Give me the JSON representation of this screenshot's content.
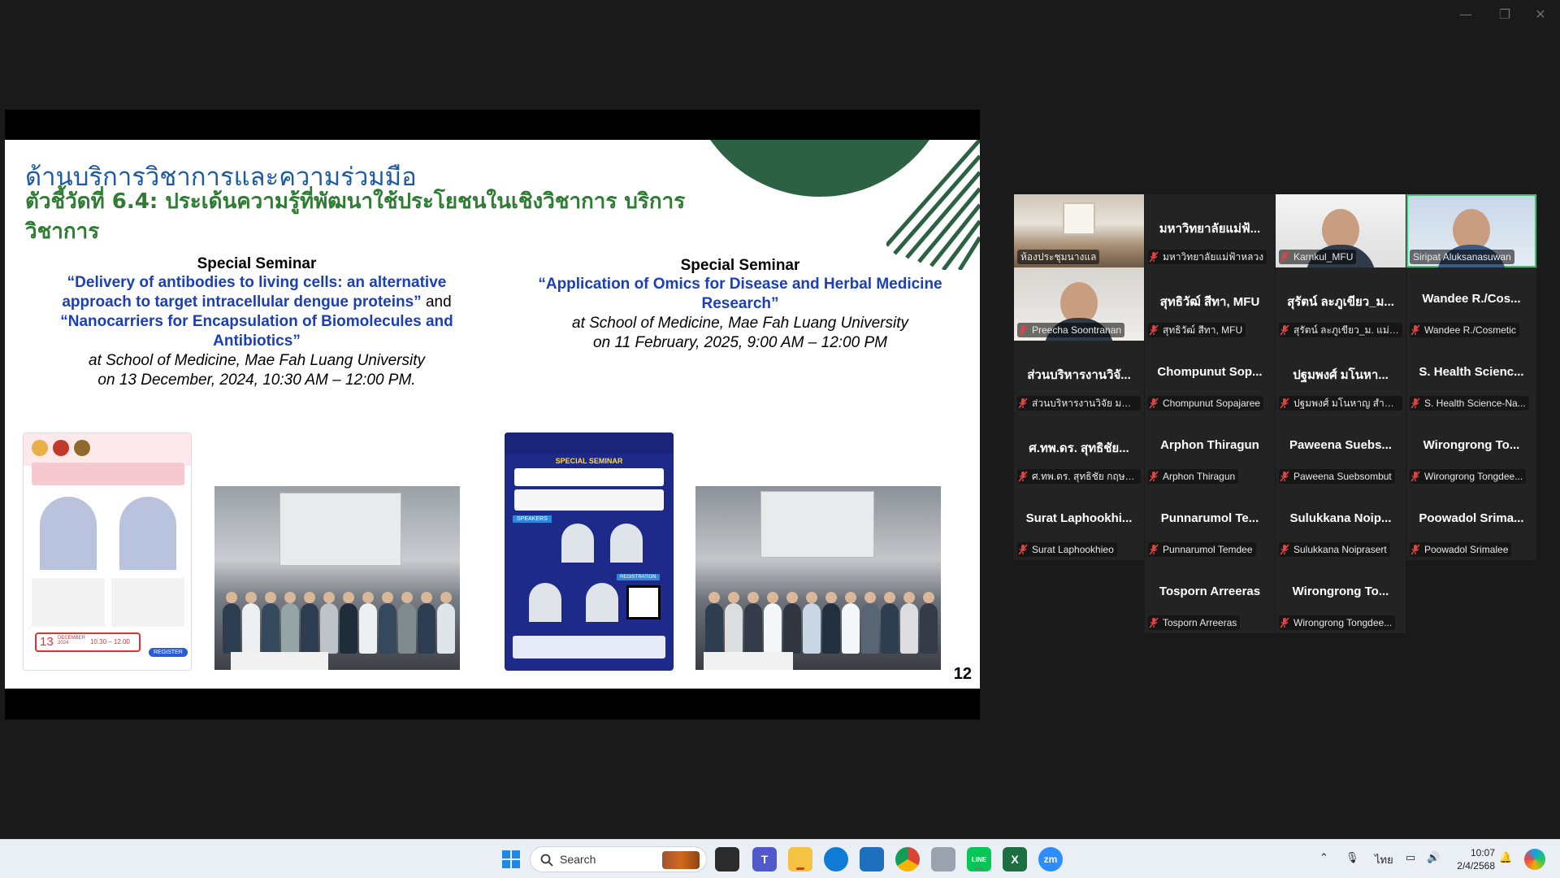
{
  "window": {
    "minimize": "—",
    "restore": "❐",
    "close": "✕"
  },
  "slide": {
    "heading": "ด้านบริการวิชาการและความร่วมมือ",
    "subheading": "ตัวชี้วัดที่ 6.4: ประเด้นความรู้ที่พัฒนาใช้ประโยชนในเชิงวิชาการ บริการวิชาการ",
    "seminar1": {
      "kind": "Special Seminar",
      "title_a": "“Delivery of antibodies to living cells: an alternative approach to target intracellular dengue proteins”",
      "and": "and",
      "title_b": "“Nanocarriers for Encapsulation of Biomolecules and Antibiotics”",
      "venue": "at School of Medicine, Mae Fah Luang University",
      "date": "on 13 December, 2024, 10:30 AM – 12:00 PM."
    },
    "seminar2": {
      "kind": "Special Seminar",
      "title": "“Application of Omics for Disease and Herbal Medicine Research”",
      "venue": "at School of Medicine, Mae Fah Luang University",
      "date": "on 11 February, 2025, 9:00 AM – 12:00 PM"
    },
    "poster1": {
      "day": "13",
      "month": "DECEMBER 2024",
      "time": "10.30 – 12.00",
      "register": "REGISTER"
    },
    "poster2": {
      "banner": "SPECIAL SEMINAR",
      "speakers": "SPEAKERS",
      "registration": "REGISTRATION"
    },
    "page_number": "12"
  },
  "participants": [
    {
      "big": "",
      "label": "ห้องประชุมนางแล",
      "muted": false,
      "video": "room"
    },
    {
      "big": "มหาวิทยาลัยแม่ฟ้...",
      "label": "มหาวิทยาลัยแม่ฟ้าหลวง",
      "muted": true,
      "video": ""
    },
    {
      "big": "",
      "label": "Karnkul_MFU",
      "muted": true,
      "video": "light"
    },
    {
      "big": "",
      "label": "Siripat Aluksanasuwan",
      "muted": false,
      "video": "blue",
      "active": true
    },
    {
      "big": "",
      "label": "Preecha Soontranan",
      "muted": true,
      "video": "person"
    },
    {
      "big": "สุทธิวัฒ์ สีทา, MFU",
      "label": "สุทธิวัฒ์ สีทา, MFU",
      "muted": true,
      "video": ""
    },
    {
      "big": "สุรัตน์ ละภูเขียว_ม...",
      "label": "สุรัตน์ ละภูเขียว_ม. แม่ฟ้า...",
      "muted": true,
      "video": ""
    },
    {
      "big": "Wandee R./Cos...",
      "label": "Wandee R./Cosmetic",
      "muted": true,
      "video": ""
    },
    {
      "big": "ส่วนบริหารงานวิจั...",
      "label": "ส่วนบริหารงานวิจัย มหาวิ...",
      "muted": true,
      "video": ""
    },
    {
      "big": "Chompunut Sop...",
      "label": "Chompunut Sopajaree",
      "muted": true,
      "video": ""
    },
    {
      "big": "ปฐมพงศ์ มโนหา...",
      "label": "ปฐมพงศ์ มโนหาญ สำนัก...",
      "muted": true,
      "video": ""
    },
    {
      "big": "S. Health Scienc...",
      "label": "S. Health Science-Na...",
      "muted": true,
      "video": ""
    },
    {
      "big": "ศ.ทพ.ดร. สุทธิชัย...",
      "label": "ศ.ทพ.ดร. สุทธิชัย กฤษณ...",
      "muted": true,
      "video": ""
    },
    {
      "big": "Arphon Thiragun",
      "label": "Arphon Thiragun",
      "muted": true,
      "video": ""
    },
    {
      "big": "Paweena Suebs...",
      "label": "Paweena Suebsombut",
      "muted": true,
      "video": ""
    },
    {
      "big": "Wirongrong To...",
      "label": "Wirongrong Tongdee...",
      "muted": true,
      "video": ""
    },
    {
      "big": "Surat Laphookhi...",
      "label": "Surat Laphookhieo",
      "muted": true,
      "video": ""
    },
    {
      "big": "Punnarumol Te...",
      "label": "Punnarumol Temdee",
      "muted": true,
      "video": ""
    },
    {
      "big": "Sulukkana Noip...",
      "label": "Sulukkana Noiprasert",
      "muted": true,
      "video": ""
    },
    {
      "big": "Poowadol Srima...",
      "label": "Poowadol Srimalee",
      "muted": true,
      "video": ""
    },
    {
      "big": "Tosporn Arreeras",
      "label": "Tosporn Arreeras",
      "muted": true,
      "video": ""
    },
    {
      "big": "Wirongrong To...",
      "label": "Wirongrong Tongdee...",
      "muted": true,
      "video": ""
    }
  ],
  "taskbar": {
    "search_label": "Search",
    "language": "ไทย",
    "time": "10:07",
    "date": "2/4/2568",
    "zoom_label": "zm",
    "teams_label": "T",
    "excel_label": "X",
    "line_label": "LINE"
  },
  "colors": {
    "accent_active": "#2ecc71",
    "muted_mic": "#e04343",
    "slide_green": "#2d6144"
  }
}
